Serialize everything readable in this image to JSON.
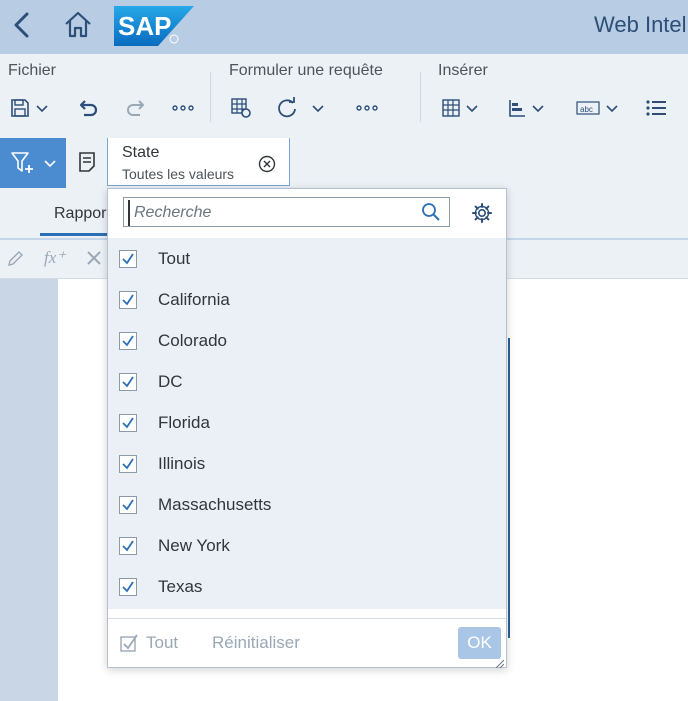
{
  "header": {
    "app_title": "Web Intel",
    "logo_text": "SAP",
    "icons": [
      "chevron-left-icon",
      "home-icon",
      "sap-logo"
    ]
  },
  "toolbar": {
    "groups": [
      {
        "label": "Fichier",
        "icons": [
          "save-icon",
          "undo-icon",
          "redo-icon",
          "more-icon"
        ]
      },
      {
        "label": "Formuler une requête",
        "icons": [
          "query-settings-icon",
          "refresh-icon",
          "more-icon"
        ]
      },
      {
        "label": "Insérer",
        "icons": [
          "table-icon",
          "bar-chart-icon",
          "text-cell-icon",
          "list-icon"
        ]
      }
    ]
  },
  "filter_bar": {
    "chip": {
      "title": "State",
      "subtitle": "Toutes les valeurs"
    }
  },
  "tabs": [
    {
      "label": "Rappor"
    }
  ],
  "dropdown": {
    "search": {
      "placeholder": "Recherche",
      "value": ""
    },
    "items": [
      {
        "label": "Tout",
        "checked": true
      },
      {
        "label": "California",
        "checked": true
      },
      {
        "label": "Colorado",
        "checked": true
      },
      {
        "label": "DC",
        "checked": true
      },
      {
        "label": "Florida",
        "checked": true
      },
      {
        "label": "Illinois",
        "checked": true
      },
      {
        "label": "Massachusetts",
        "checked": true
      },
      {
        "label": "New York",
        "checked": true
      },
      {
        "label": "Texas",
        "checked": true
      }
    ],
    "footer": {
      "select_all_label": "Tout",
      "reset_label": "Réinitialiser",
      "ok_label": "OK"
    }
  },
  "colors": {
    "accent": "#4b8bd0",
    "header_bg": "#b8cde3",
    "toolbar_bg": "#ecf1f6",
    "checkmark": "#2c6fb7",
    "disabled_text": "#9aa8b6"
  }
}
